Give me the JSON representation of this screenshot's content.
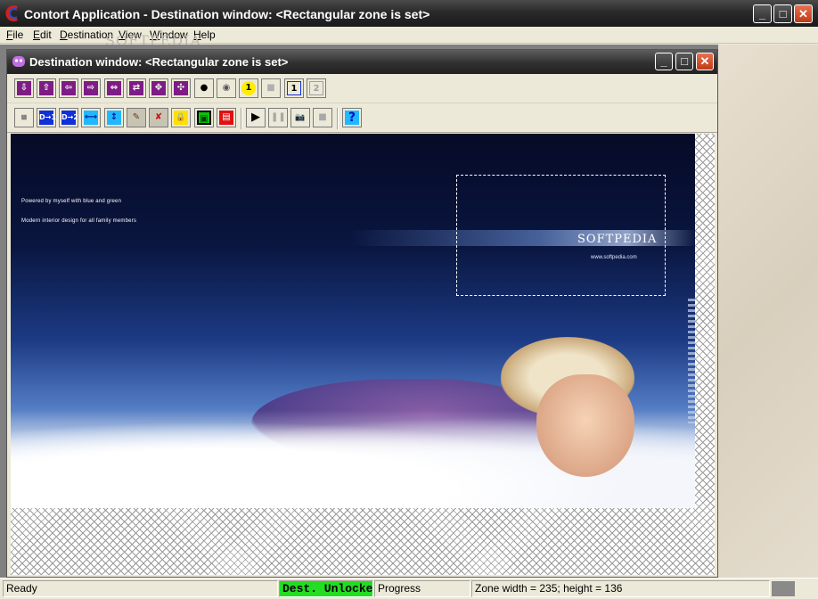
{
  "app": {
    "title": "Contort Application - Destination window: <Rectangular zone is set>",
    "window_buttons": {
      "minimize": "_",
      "maximize": "□",
      "close": "✕"
    }
  },
  "menu": {
    "items": [
      {
        "label": "File",
        "accel": "F",
        "rest": "ile"
      },
      {
        "label": "Edit",
        "accel": "E",
        "rest": "dit"
      },
      {
        "label": "Destination",
        "accel": "D",
        "rest": "estination"
      },
      {
        "label": "View",
        "accel": "V",
        "rest": "iew"
      },
      {
        "label": "Window",
        "accel": "W",
        "rest": "indow"
      },
      {
        "label": "Help",
        "accel": "H",
        "rest": "elp"
      }
    ],
    "watermark": "SOFTPEDIA"
  },
  "child": {
    "title": "Destination window: <Rectangular zone is set>"
  },
  "toolbar1": {
    "icons": [
      "arrow-down-icon",
      "arrow-up-icon",
      "arrow-left-icon",
      "arrow-right-icon",
      "expand-horizontal-icon",
      "shrink-horizontal-icon",
      "expand-all-icon",
      "shrink-all-icon",
      "point-icon",
      "blur-point-icon",
      "point-1-icon",
      "zone-icon",
      "zone-1-icon",
      "zone-2-icon"
    ],
    "labels": [
      "⇩",
      "⇧",
      "⇦",
      "⇨",
      "⇔",
      "⇄",
      "✥",
      "✣",
      "●",
      "◉",
      "1",
      "■",
      "1",
      "2"
    ]
  },
  "toolbar2": {
    "icons": [
      "mask-icon",
      "destination-1-icon",
      "destination-2-icon",
      "stretch-horizontal-icon",
      "stretch-vertical-icon",
      "brush-icon",
      "erase-brush-icon",
      "lock-icon",
      "frame-icon",
      "flag-icon",
      "play-icon",
      "pause-icon",
      "camera-icon",
      "stop-icon",
      "help-icon"
    ],
    "labels": [
      "⩏",
      "D→1",
      "D→2",
      "⟷",
      "↕",
      "✎",
      "✘",
      "🔒",
      "▣",
      "▤",
      "▶",
      "❚❚",
      "📷",
      "■",
      "?"
    ]
  },
  "picture": {
    "text_line1": "Powered by myself with blue and green",
    "text_line2": "Modern interior design for all family members",
    "logo": "SOFTPEDIA",
    "logo_url": "www.softpedia.com"
  },
  "status": {
    "ready": "Ready",
    "lock_state": "Dest. Unlocked",
    "progress": "Progress",
    "zone_info": "Zone width = 235; height = 136"
  },
  "colors": {
    "lock_state_bg": "#22dd22",
    "toolbar_purple": "#7e1c86",
    "toolbar_blue": "#1030d8"
  }
}
